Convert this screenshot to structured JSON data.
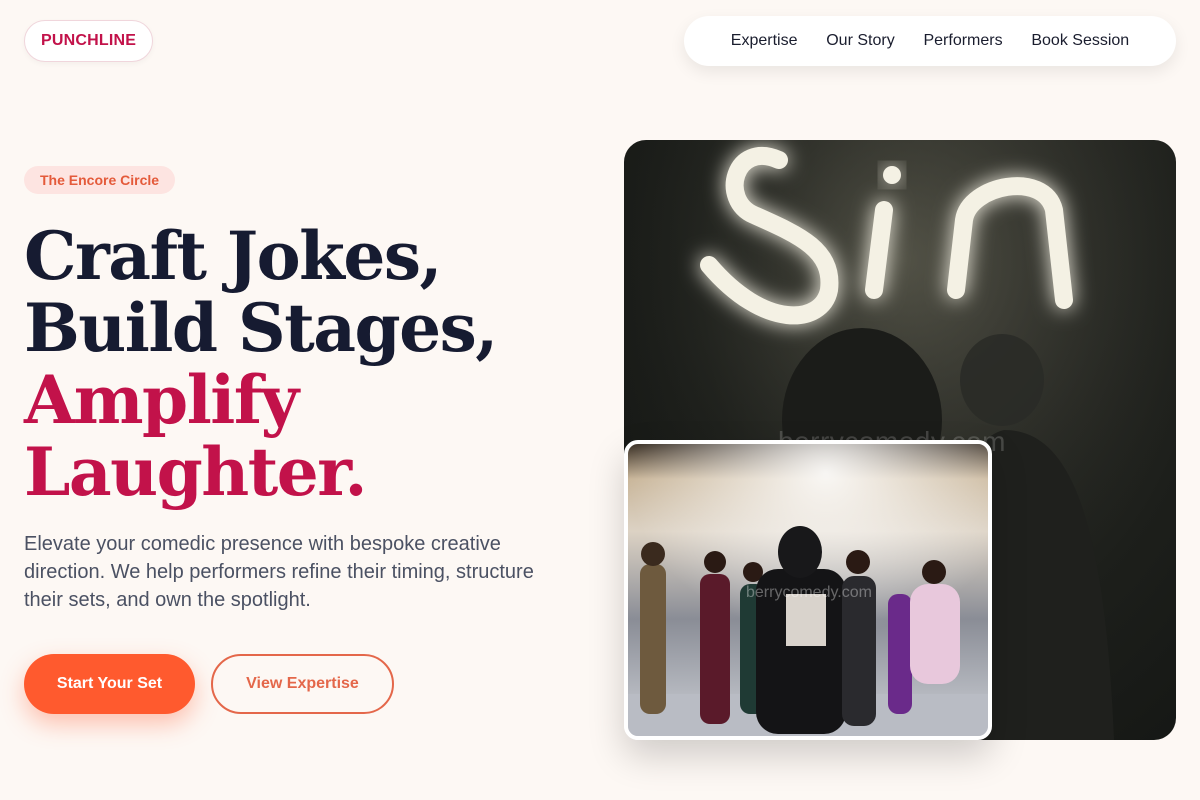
{
  "brand": {
    "logo": "PUNCHLINE"
  },
  "nav": {
    "items": [
      {
        "label": "Expertise"
      },
      {
        "label": "Our Story"
      },
      {
        "label": "Performers"
      },
      {
        "label": "Book Session"
      }
    ]
  },
  "hero": {
    "badge": "The Encore Circle",
    "headline": {
      "line1": "Craft Jokes,",
      "line2": "Build Stages,",
      "line3": "Amplify",
      "line4": "Laughter."
    },
    "subtext": "Elevate your comedic presence with bespoke creative direction. We help performers refine their timing, structure their sets, and own the spotlight.",
    "primary_cta": "Start Your Set",
    "secondary_cta": "View Expertise"
  },
  "photos": {
    "main_neon_text": "Sin",
    "watermark": "berrycomedy.com",
    "inset_watermark": "berrycomedy.com"
  },
  "colors": {
    "accent": "#c2124a",
    "cta": "#ff5a2e",
    "background": "#fdf8f4",
    "text_dark": "#161b31"
  }
}
